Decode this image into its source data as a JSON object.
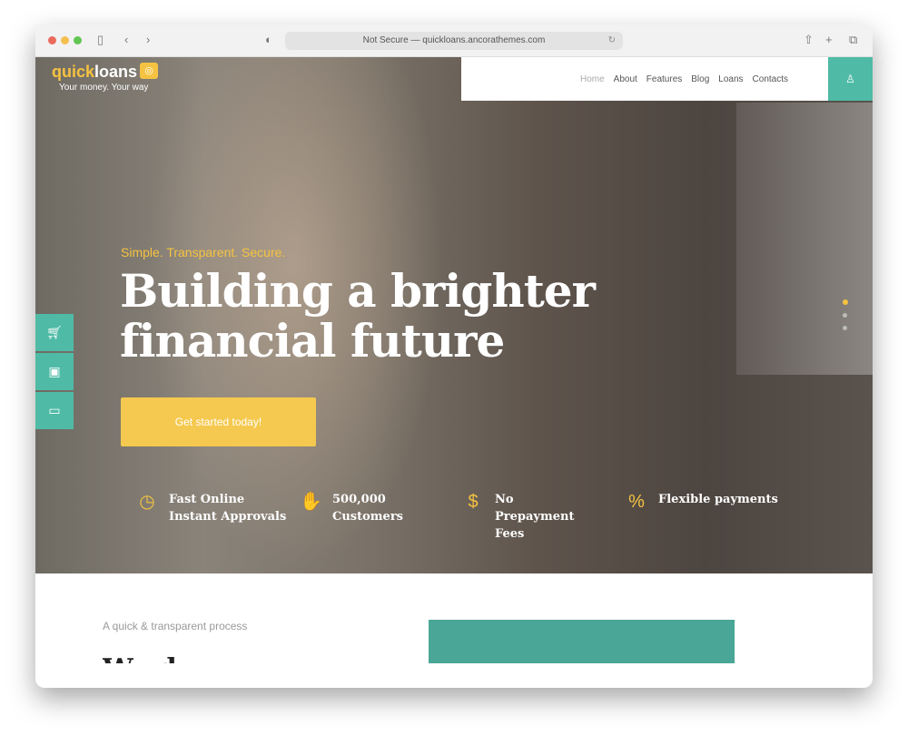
{
  "browser": {
    "url": "Not Secure — quickloans.ancorathemes.com"
  },
  "logo": {
    "part1": "quick",
    "part2": "loans",
    "tagline": "Your money. Your way"
  },
  "nav": {
    "items": [
      "Home",
      "About",
      "Features",
      "Blog",
      "Loans",
      "Contacts"
    ]
  },
  "hero": {
    "eyebrow": "Simple. Transparent. Secure.",
    "title_line1": "Building a brighter",
    "title_line2": "financial future",
    "cta": "Get started today!"
  },
  "features": [
    {
      "icon": "clock-icon",
      "label": "Fast Online Instant Approvals"
    },
    {
      "icon": "handshake-icon",
      "label": "500,000 Customers"
    },
    {
      "icon": "dollar-coin-icon",
      "label": "No Prepayment Fees"
    },
    {
      "icon": "percent-document-icon",
      "label": "Flexible payments"
    }
  ],
  "section": {
    "subtitle": "A quick & transparent process",
    "heading_peek": "We do"
  },
  "colors": {
    "accent_teal": "#4fbba6",
    "accent_yellow": "#f5c341"
  }
}
